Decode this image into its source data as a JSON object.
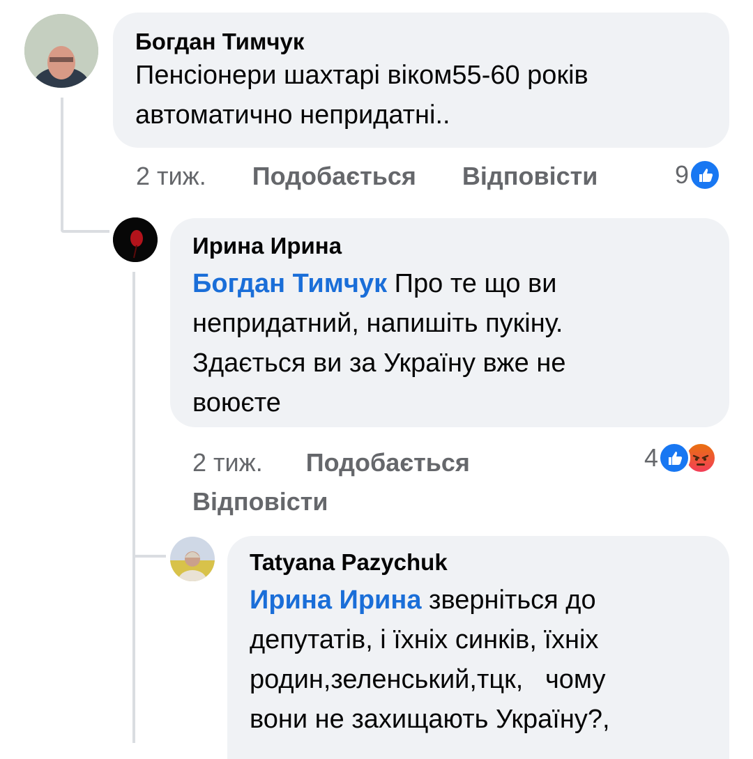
{
  "comments": [
    {
      "author": "Богдан Тимчук",
      "mention": "",
      "text_lines": [
        "Пенсіонери шахтарі віком55-60 років",
        "автоматично непридатні.."
      ],
      "time": "2 тиж.",
      "like_label": "Подобається",
      "reply_label": "Відповісти",
      "reaction_count": "9",
      "reactions": [
        "like-icon"
      ]
    },
    {
      "author": "Ирина Ирина",
      "mention": "Богдан Тимчук",
      "text_lines": [
        " Про те що ви",
        "непридатний, напишіть пукіну.",
        "Здається ви за Україну вже не",
        "воюєте"
      ],
      "time": "2 тиж.",
      "like_label": "Подобається",
      "reply_label": "Відповісти",
      "reaction_count": "4",
      "reactions": [
        "like-icon",
        "angry-icon"
      ]
    },
    {
      "author": "Tatyana Pazychuk",
      "mention": "Ирина Ирина",
      "text_lines": [
        " зверніться до",
        "депутатів, і їхніх синків, їхніх",
        "родин,зеленський,тцк,   чому",
        "вони не захищають Україну?,"
      ]
    }
  ],
  "colors": {
    "bubble": "#f0f2f5",
    "mention": "#1a6ed8",
    "meta": "#65676b",
    "like": "#1877f2",
    "angry": "#f33e58"
  }
}
